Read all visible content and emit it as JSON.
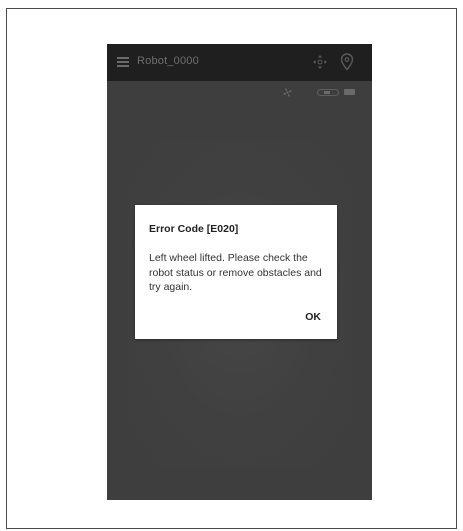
{
  "app_bar": {
    "title": "Robot_0000",
    "icons": [
      "menu-icon",
      "dpad-icon",
      "location-pin-icon"
    ]
  },
  "status_bar": {
    "icons": [
      "fan-icon",
      "toggle-icon",
      "battery-icon"
    ]
  },
  "error_dialog": {
    "title": "Error Code [E020]",
    "message": "Left wheel lifted. Please check the robot status or remove obstacles and try again.",
    "ok_label": "OK"
  },
  "colors": {
    "app_background": "#3e3e3e",
    "app_bar": "#1f1f1f",
    "dialog_background": "#ffffff",
    "frame_border": "#4a4a4a"
  }
}
